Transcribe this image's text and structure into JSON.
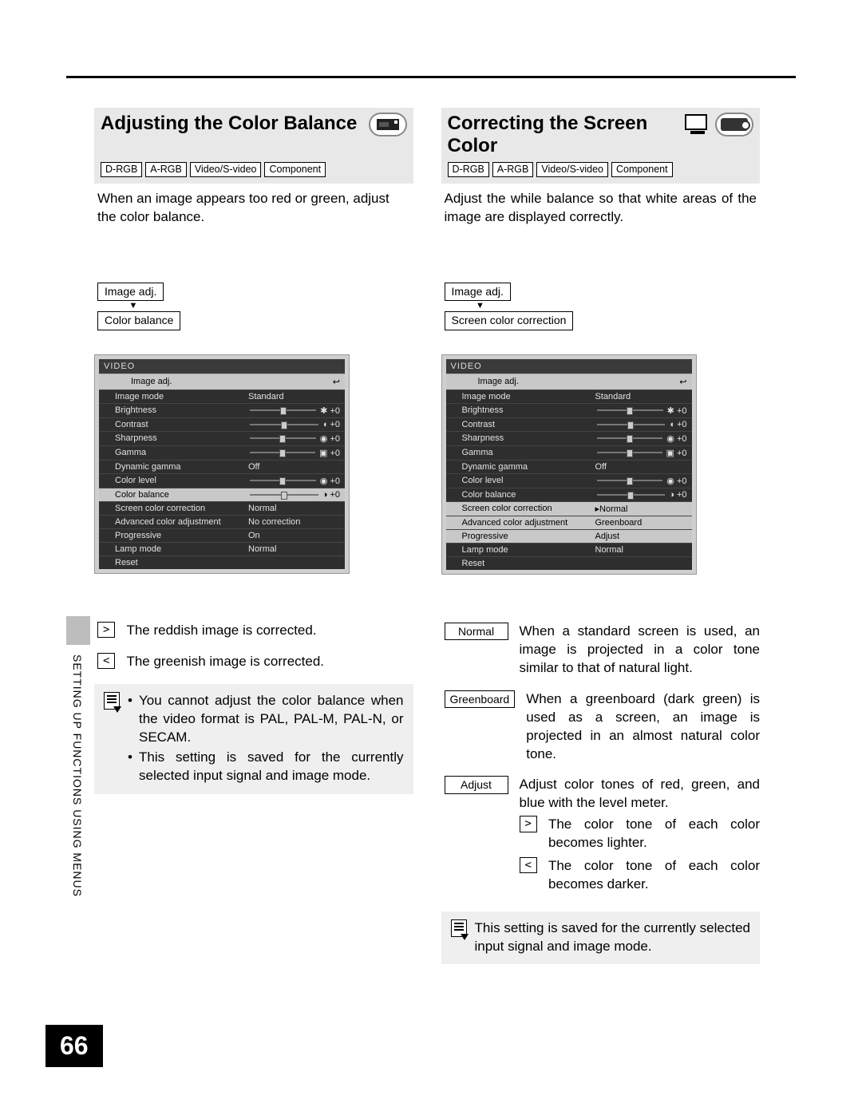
{
  "page_number": "66",
  "side_label": "SETTING UP FUNCTIONS USING MENUS",
  "tags": [
    "D-RGB",
    "A-RGB",
    "Video/S-video",
    "Component"
  ],
  "left": {
    "title": "Adjusting the Color Balance",
    "intro": "When an image appears too red or green, adjust the color balance.",
    "crumb_top": "Image adj.",
    "crumb_bottom": "Color balance",
    "menu": {
      "header": "VIDEO",
      "tab": "Image adj.",
      "highlight": "Color balance",
      "rows": [
        {
          "label": "Image mode",
          "val": "Standard",
          "slider": false
        },
        {
          "label": "Brightness",
          "val": "✱ +0",
          "slider": true
        },
        {
          "label": "Contrast",
          "val": "◖ +0",
          "slider": true
        },
        {
          "label": "Sharpness",
          "val": "◉ +0",
          "slider": true
        },
        {
          "label": "Gamma",
          "val": "▣ +0",
          "slider": true
        },
        {
          "label": "Dynamic gamma",
          "val": "Off",
          "slider": false
        },
        {
          "label": "Color level",
          "val": "◉ +0",
          "slider": true
        },
        {
          "label": "Color balance",
          "val": "◑ +0",
          "slider": true,
          "sel": true
        },
        {
          "label": "Screen color correction",
          "val": "Normal",
          "slider": false
        },
        {
          "label": "Advanced color adjustment",
          "val": "No correction",
          "slider": false
        },
        {
          "label": "Progressive",
          "val": "On",
          "slider": false
        },
        {
          "label": "Lamp mode",
          "val": "Normal",
          "slider": false
        },
        {
          "label": "Reset",
          "val": "",
          "slider": false
        }
      ]
    },
    "keys": [
      {
        "k": ">",
        "t": "The reddish image is corrected."
      },
      {
        "k": "<",
        "t": "The greenish image is corrected."
      }
    ],
    "notes": [
      "You cannot adjust the color balance when the video format is PAL, PAL-M, PAL-N, or SECAM.",
      "This setting is saved for the currently selected input signal and image mode."
    ]
  },
  "right": {
    "title": "Correcting the Screen Color",
    "intro": "Adjust the while balance so that white areas of the image are displayed correctly.",
    "crumb_top": "Image adj.",
    "crumb_bottom": "Screen color correction",
    "menu": {
      "header": "VIDEO",
      "tab": "Image adj.",
      "highlight": "Screen color correction",
      "rows": [
        {
          "label": "Image mode",
          "val": "Standard",
          "slider": false
        },
        {
          "label": "Brightness",
          "val": "✱ +0",
          "slider": true
        },
        {
          "label": "Contrast",
          "val": "◖ +0",
          "slider": true
        },
        {
          "label": "Sharpness",
          "val": "◉ +0",
          "slider": true
        },
        {
          "label": "Gamma",
          "val": "▣ +0",
          "slider": true
        },
        {
          "label": "Dynamic gamma",
          "val": "Off",
          "slider": false
        },
        {
          "label": "Color level",
          "val": "◉ +0",
          "slider": true
        },
        {
          "label": "Color balance",
          "val": "◑ +0",
          "slider": true
        },
        {
          "label": "Screen color correction",
          "val": "▸Normal",
          "slider": false,
          "sel": true
        },
        {
          "label": "Advanced color adjustment",
          "val": "Greenboard",
          "slider": false,
          "pop": true
        },
        {
          "label": "Progressive",
          "val": "Adjust",
          "slider": false,
          "pop": true
        },
        {
          "label": "Lamp mode",
          "val": "Normal",
          "slider": false
        },
        {
          "label": "Reset",
          "val": "",
          "slider": false
        }
      ]
    },
    "options": [
      {
        "k": "Normal",
        "t": "When a standard screen is used, an image is projected in a color tone similar to that of natural light."
      },
      {
        "k": "Greenboard",
        "t": "When a greenboard (dark green) is used as a screen, an image is projected in an almost natural color tone."
      },
      {
        "k": "Adjust",
        "t": "Adjust color tones of red, green, and blue with the level meter.",
        "sub": [
          {
            "k": ">",
            "t": "The color tone of each color becomes lighter."
          },
          {
            "k": "<",
            "t": "The color tone of each color becomes darker."
          }
        ]
      }
    ],
    "note": "This setting is saved for the currently selected input signal and image mode."
  }
}
